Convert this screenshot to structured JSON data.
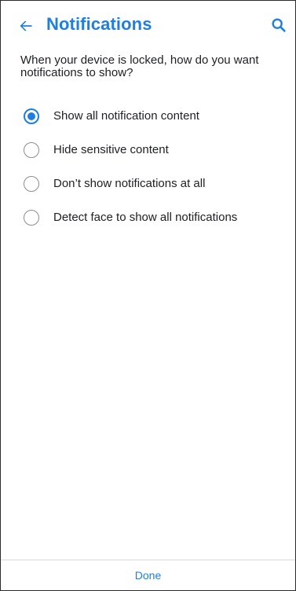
{
  "header": {
    "title": "Notifications",
    "back_icon": "arrow-back-icon",
    "search_icon": "search-icon"
  },
  "question": "When your device is locked, how do you want notifications to show?",
  "options": [
    {
      "label": "Show all notification content",
      "selected": true
    },
    {
      "label": "Hide sensitive content",
      "selected": false
    },
    {
      "label": "Don’t show notifications at all",
      "selected": false
    },
    {
      "label": "Detect face to show all notifications",
      "selected": false
    }
  ],
  "footer": {
    "done_label": "Done"
  },
  "colors": {
    "accent": "#1f7fe0",
    "text": "#202124",
    "radio_off": "#8d8d8d"
  }
}
